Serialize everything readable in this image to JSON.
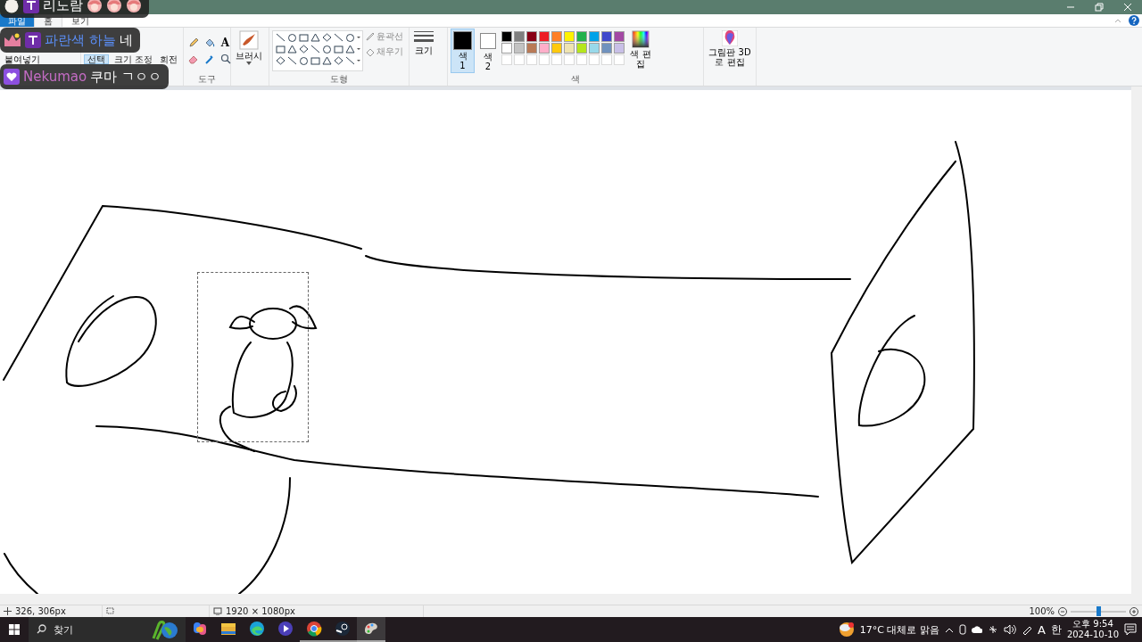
{
  "ribbon": {
    "tabs": [
      {
        "label": "파일",
        "kind": "file",
        "selected": false
      },
      {
        "label": "홈",
        "kind": "tab",
        "selected": true
      },
      {
        "label": "보기",
        "kind": "tab",
        "selected": false
      }
    ],
    "clipboard": {
      "paste": "붙여넣기"
    },
    "image": {
      "select": {
        "label": "선택",
        "selected": true
      },
      "resize": "크기 조정",
      "rotate": "회전"
    },
    "tools": {
      "label": "도구",
      "items": [
        {
          "kind": "pencil"
        },
        {
          "kind": "fill"
        },
        {
          "kind": "text",
          "glyph": "A"
        },
        {
          "kind": "eraser"
        },
        {
          "kind": "picker"
        },
        {
          "kind": "magnifier"
        }
      ]
    },
    "brushes": {
      "label": "브러시"
    },
    "shapes": {
      "label": "도형",
      "outline": {
        "label": "윤곽선",
        "disabled": true
      },
      "fill": {
        "label": "채우기",
        "disabled": true
      }
    },
    "size": {
      "label": "크기"
    },
    "colors": {
      "label": "색",
      "color1": {
        "label": "색 1",
        "color": "#000000",
        "selected": true
      },
      "color2": {
        "label": "색 2",
        "color": "#ffffff",
        "selected": false
      },
      "palette": [
        {
          "kind": "color",
          "color": "#000000"
        },
        {
          "kind": "color",
          "color": "#7f7f7f"
        },
        {
          "kind": "color",
          "color": "#880015"
        },
        {
          "kind": "color",
          "color": "#ed1c24"
        },
        {
          "kind": "color",
          "color": "#ff7f27"
        },
        {
          "kind": "color",
          "color": "#fff200"
        },
        {
          "kind": "color",
          "color": "#22b14c"
        },
        {
          "kind": "color",
          "color": "#00a2e8"
        },
        {
          "kind": "color",
          "color": "#3f48cc"
        },
        {
          "kind": "color",
          "color": "#a349a4"
        },
        {
          "kind": "color",
          "color": "#ffffff"
        },
        {
          "kind": "color",
          "color": "#c3c3c3"
        },
        {
          "kind": "color",
          "color": "#b97a57"
        },
        {
          "kind": "color",
          "color": "#ffaec9"
        },
        {
          "kind": "color",
          "color": "#ffc90e"
        },
        {
          "kind": "color",
          "color": "#efe4b0"
        },
        {
          "kind": "color",
          "color": "#b5e61d"
        },
        {
          "kind": "color",
          "color": "#99d9ea"
        },
        {
          "kind": "color",
          "color": "#7092be"
        },
        {
          "kind": "color",
          "color": "#c8bfe7"
        },
        {
          "kind": "empty"
        },
        {
          "kind": "empty"
        },
        {
          "kind": "empty"
        },
        {
          "kind": "empty"
        },
        {
          "kind": "empty"
        },
        {
          "kind": "empty"
        },
        {
          "kind": "empty"
        },
        {
          "kind": "empty"
        },
        {
          "kind": "empty"
        },
        {
          "kind": "empty"
        }
      ],
      "edit": "색 편집"
    },
    "paint3d": "그림판 3D로 편집"
  },
  "status_bar": {
    "position": "326, 306px",
    "canvas_size": "1920 × 1080px",
    "zoom": "100%",
    "zoom_slider": {
      "level": 0.5
    }
  },
  "taskbar": {
    "search": {
      "placeholder": "찾기"
    },
    "apps": [
      {
        "kind": "copilot",
        "open": false,
        "selected": false
      },
      {
        "kind": "folder",
        "open": false,
        "selected": false
      },
      {
        "kind": "edge",
        "open": false,
        "selected": false
      },
      {
        "kind": "video",
        "open": false,
        "selected": false
      },
      {
        "kind": "chrome",
        "open": true,
        "selected": false
      },
      {
        "kind": "steam",
        "open": true,
        "selected": false
      },
      {
        "kind": "paint",
        "open": true,
        "selected": true
      }
    ],
    "weather": "17°C 대체로 맑음",
    "ime_mode": "A",
    "ime_lang": "한",
    "time": "오후 9:54",
    "date": "2024-10-10"
  },
  "chat_overlay": [
    {
      "badges": [
        {
          "kind": "avatar"
        },
        {
          "kind": "sub"
        }
      ],
      "user": "리노람",
      "color": "#ffffff",
      "emotes": [
        {
          "kind": "picture"
        },
        {
          "kind": "picture"
        },
        {
          "kind": "picture"
        }
      ]
    },
    {
      "badges": [
        {
          "kind": "crown"
        },
        {
          "kind": "sub"
        }
      ],
      "user": "파란색 하늘",
      "color": "#5b8ff9",
      "text": "네"
    },
    {
      "badges": [
        {
          "kind": "heart"
        }
      ],
      "user": "Nekumao",
      "color": "#c46cc4",
      "text": "쿠마 ㄱㅇㅇ"
    }
  ]
}
